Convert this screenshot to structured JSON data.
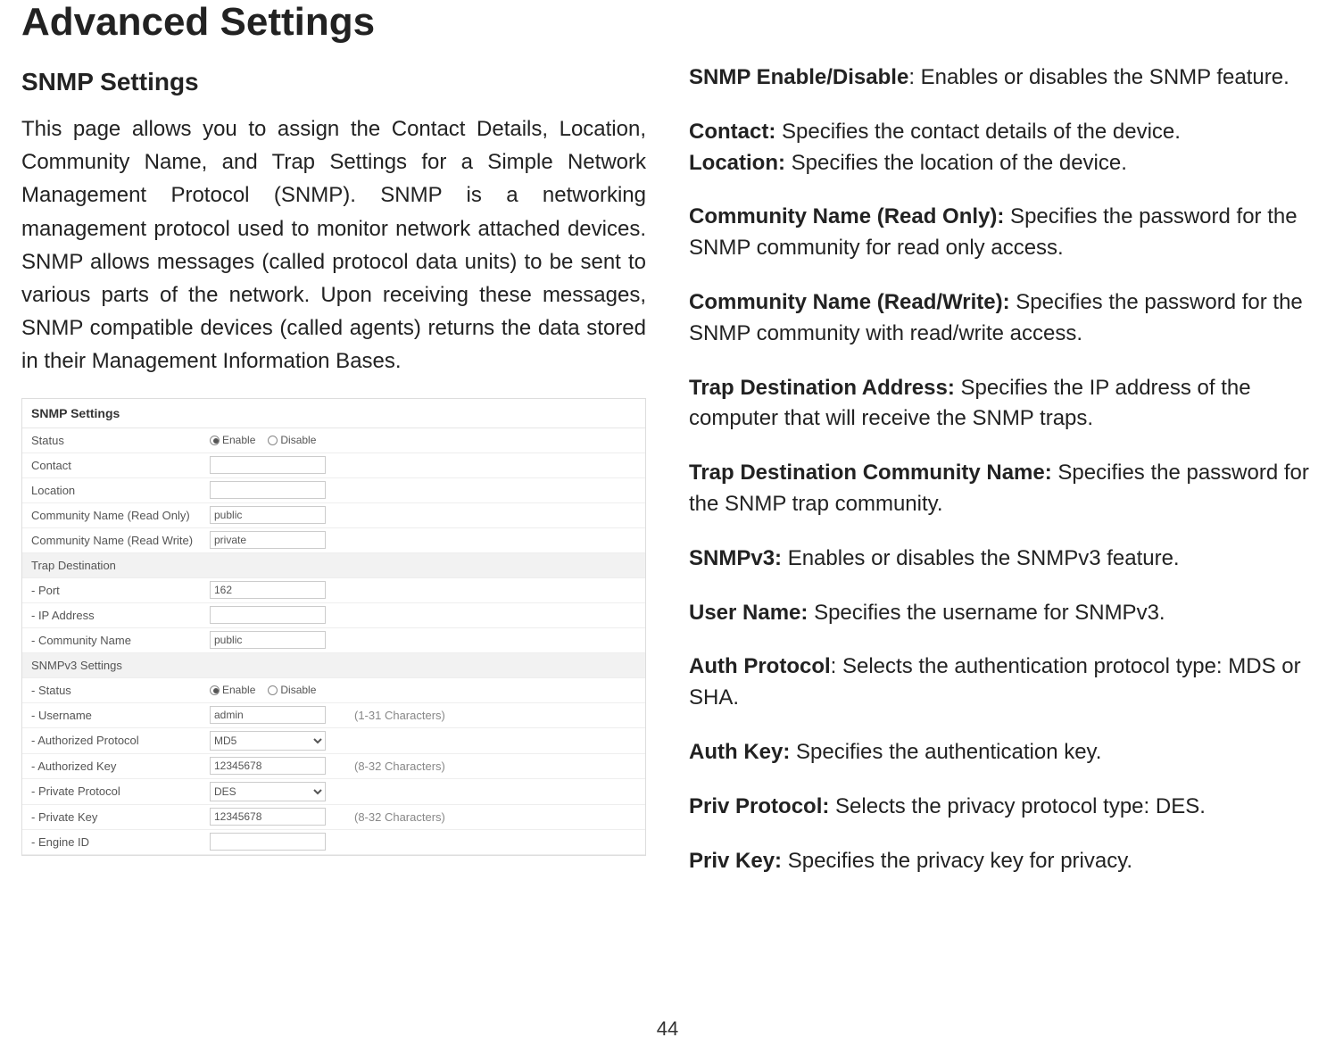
{
  "page_number": "44",
  "title": "Advanced Settings",
  "left": {
    "subheading": "SNMP Settings",
    "body": "This page allows you to assign the Contact Details, Location, Community Name, and Trap Settings for a Simple Network Management Protocol (SNMP). SNMP is a networking management protocol used to monitor network attached devices. SNMP allows messages (called protocol data units) to be sent to various parts of the network. Upon receiving these messages, SNMP compatible devices (called agents) returns the data stored in their Management Information Bases."
  },
  "right": {
    "items": [
      {
        "label": "SNMP Enable/Disable",
        "text": ": Enables or disables the SNMP feature."
      },
      {
        "label": "Contact:",
        "text": " Specifies the contact details of the device."
      },
      {
        "label": "Location:",
        "text": " Specifies the location of the device."
      },
      {
        "label": "Community Name (Read Only):",
        "text": " Specifies the password for the SNMP community for read only access."
      },
      {
        "label": "Community Name (Read/Write):",
        "text": " Specifies the password for the SNMP community with read/write access."
      },
      {
        "label": "Trap Destination Address:",
        "text": " Specifies the IP address of the computer that will receive the SNMP traps."
      },
      {
        "label": "Trap Destination Community Name:",
        "text": " Specifies the password for the SNMP trap community."
      },
      {
        "label": "SNMPv3:",
        "text": " Enables or disables the SNMPv3 feature."
      },
      {
        "label": "User Name:",
        "text": " Specifies the username for SNMPv3."
      },
      {
        "label": "Auth Protocol",
        "text": ": Selects the authentication protocol type: MDS or SHA."
      },
      {
        "label": "Auth Key:",
        "text": " Specifies the authentication key."
      },
      {
        "label": "Priv Protocol:",
        "text": " Selects the privacy protocol type: DES."
      },
      {
        "label": "Priv Key:",
        "text": " Specifies the privacy key for privacy."
      }
    ]
  },
  "snmp": {
    "header": "SNMP Settings",
    "enable_label": "Enable",
    "disable_label": "Disable",
    "rows": {
      "status": "Status",
      "contact": "Contact",
      "location": "Location",
      "comm_ro": "Community Name (Read Only)",
      "comm_rw": "Community Name (Read Write)",
      "trap_dest": "Trap Destination",
      "port": "- Port",
      "ip": "- IP Address",
      "comm_name": "- Community Name",
      "v3_settings": "SNMPv3 Settings",
      "v3_status": "- Status",
      "username": "- Username",
      "auth_proto": "- Authorized Protocol",
      "auth_key": "- Authorized Key",
      "priv_proto": "- Private Protocol",
      "priv_key": "- Private Key",
      "engine": "- Engine ID"
    },
    "values": {
      "comm_ro": "public",
      "comm_rw": "private",
      "port": "162",
      "comm_name": "public",
      "username": "admin",
      "auth_proto": "MD5",
      "auth_key": "12345678",
      "priv_proto": "DES",
      "priv_key": "12345678"
    },
    "hints": {
      "username": "(1-31 Characters)",
      "auth_key": "(8-32 Characters)",
      "priv_key": "(8-32 Characters)"
    }
  }
}
